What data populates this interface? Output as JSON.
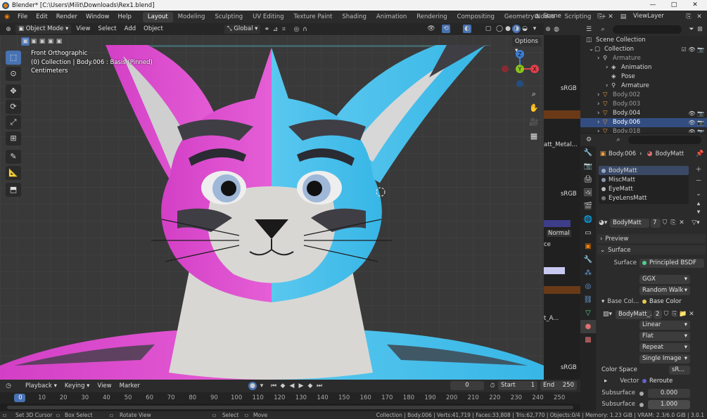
{
  "window": {
    "title": "Blender* [C:\\Users\\Milit\\Downloads\\Rex1.blend]",
    "controls": [
      "—",
      "□",
      "✕"
    ]
  },
  "menus": [
    "File",
    "Edit",
    "Render",
    "Window",
    "Help"
  ],
  "workspaces": [
    "Layout",
    "Modeling",
    "Sculpting",
    "UV Editing",
    "Texture Paint",
    "Shading",
    "Animation",
    "Rendering",
    "Compositing",
    "Geometry Nodes",
    "Scripting"
  ],
  "active_workspace": "Layout",
  "add_workspace": "+",
  "scene": {
    "label": "Scene",
    "view_layer": "ViewLayer"
  },
  "viewport_header": {
    "mode": "Object Mode",
    "menus": [
      "View",
      "Select",
      "Add",
      "Object"
    ],
    "orientation": "Global",
    "options": "Options"
  },
  "viewport_info": {
    "line1": "Front Orthographic",
    "line2": "(0) Collection | Body.006 : Basis (Pinned)",
    "line3": "Centimeters"
  },
  "gizmo": {
    "z": "Z",
    "y": "Y",
    "x": "X"
  },
  "midstrip": {
    "labels": [
      "sRGB",
      "att_Metal...",
      "sRGB",
      "Normal",
      "ce",
      "sRGB",
      "t_A...",
      "2"
    ]
  },
  "outliner": {
    "search_placeholder": "",
    "items": [
      {
        "label": "Scene Collection",
        "indent": 0,
        "color": "#d8d8d8"
      },
      {
        "label": "Collection",
        "indent": 1,
        "color": "#d8d8d8"
      },
      {
        "label": "Armature",
        "indent": 2,
        "color": "#9b9b9b"
      },
      {
        "label": "Animation",
        "indent": 3,
        "color": "#d8d8d8"
      },
      {
        "label": "Pose",
        "indent": 3,
        "color": "#d8d8d8"
      },
      {
        "label": "Armature",
        "indent": 3,
        "color": "#d8d8d8"
      },
      {
        "label": "Body.002",
        "indent": 2,
        "color": "#9b9b9b"
      },
      {
        "label": "Body.003",
        "indent": 2,
        "color": "#9b9b9b"
      },
      {
        "label": "Body.004",
        "indent": 2,
        "color": "#d8d8d8"
      },
      {
        "label": "Body.006",
        "indent": 2,
        "color": "#ffffff"
      },
      {
        "label": "Body.018",
        "indent": 2,
        "color": "#9b9b9b"
      }
    ]
  },
  "properties": {
    "breadcrumb_object": "Body.006",
    "breadcrumb_material": "BodyMatt",
    "material_slots": [
      "BodyMatt",
      "MiscMatt",
      "EyeMatt",
      "EyeLensMatt"
    ],
    "material_name": "BodyMatt",
    "material_users": "7",
    "preview_label": "Preview",
    "surface_label": "Surface",
    "surface_field_label": "Surface",
    "surface_value": "Principled BSDF",
    "distribution": "GGX",
    "subsurface_method": "Random Walk",
    "base_color_label": "Base Col...",
    "base_color_value": "Base Color",
    "image_name": "BodyMatt_...",
    "image_users": "2",
    "interpolation": "Linear",
    "projection": "Flat",
    "extension": "Repeat",
    "source": "Single Image",
    "color_space_label": "Color Space",
    "color_space_value": "sR...",
    "vector_label": "Vector",
    "vector_value": "Reroute",
    "subsurface_label": "Subsurface",
    "subsurface_value": "0.000",
    "subsurface2_label": "Subsurface ...",
    "subsurface2_value": "1.000"
  },
  "timeline": {
    "menus": [
      "Playback",
      "Keying",
      "View",
      "Marker"
    ],
    "current_frame": "0",
    "start_label": "Start",
    "start": "1",
    "end_label": "End",
    "end": "250",
    "ruler": [
      "0",
      "10",
      "20",
      "30",
      "40",
      "50",
      "60",
      "70",
      "80",
      "90",
      "100",
      "110",
      "120",
      "130",
      "140",
      "150",
      "160",
      "170",
      "180",
      "190",
      "200",
      "210",
      "220",
      "230",
      "240",
      "250"
    ]
  },
  "statusbar": {
    "hints": [
      "Set 3D Cursor",
      "Box Select",
      "Rotate View",
      "Select",
      "Move"
    ],
    "stats": "Collection | Body.006 | Verts:41,719 | Faces:33,808 | Tris:62,770 | Objects:0/4 | Memory: 1.23 GiB | VRAM: 2.3/6.0 GiB | 3.0.1"
  },
  "colors": {
    "accent": "#4772b3",
    "fur_pink": "#d33fc6",
    "fur_blue": "#37b6e6",
    "fur_white": "#d9d7d4",
    "fur_dark": "#3f3e45",
    "axis_x": "#e0404a",
    "axis_y": "#8cc41e",
    "axis_z": "#3d7fd6"
  }
}
